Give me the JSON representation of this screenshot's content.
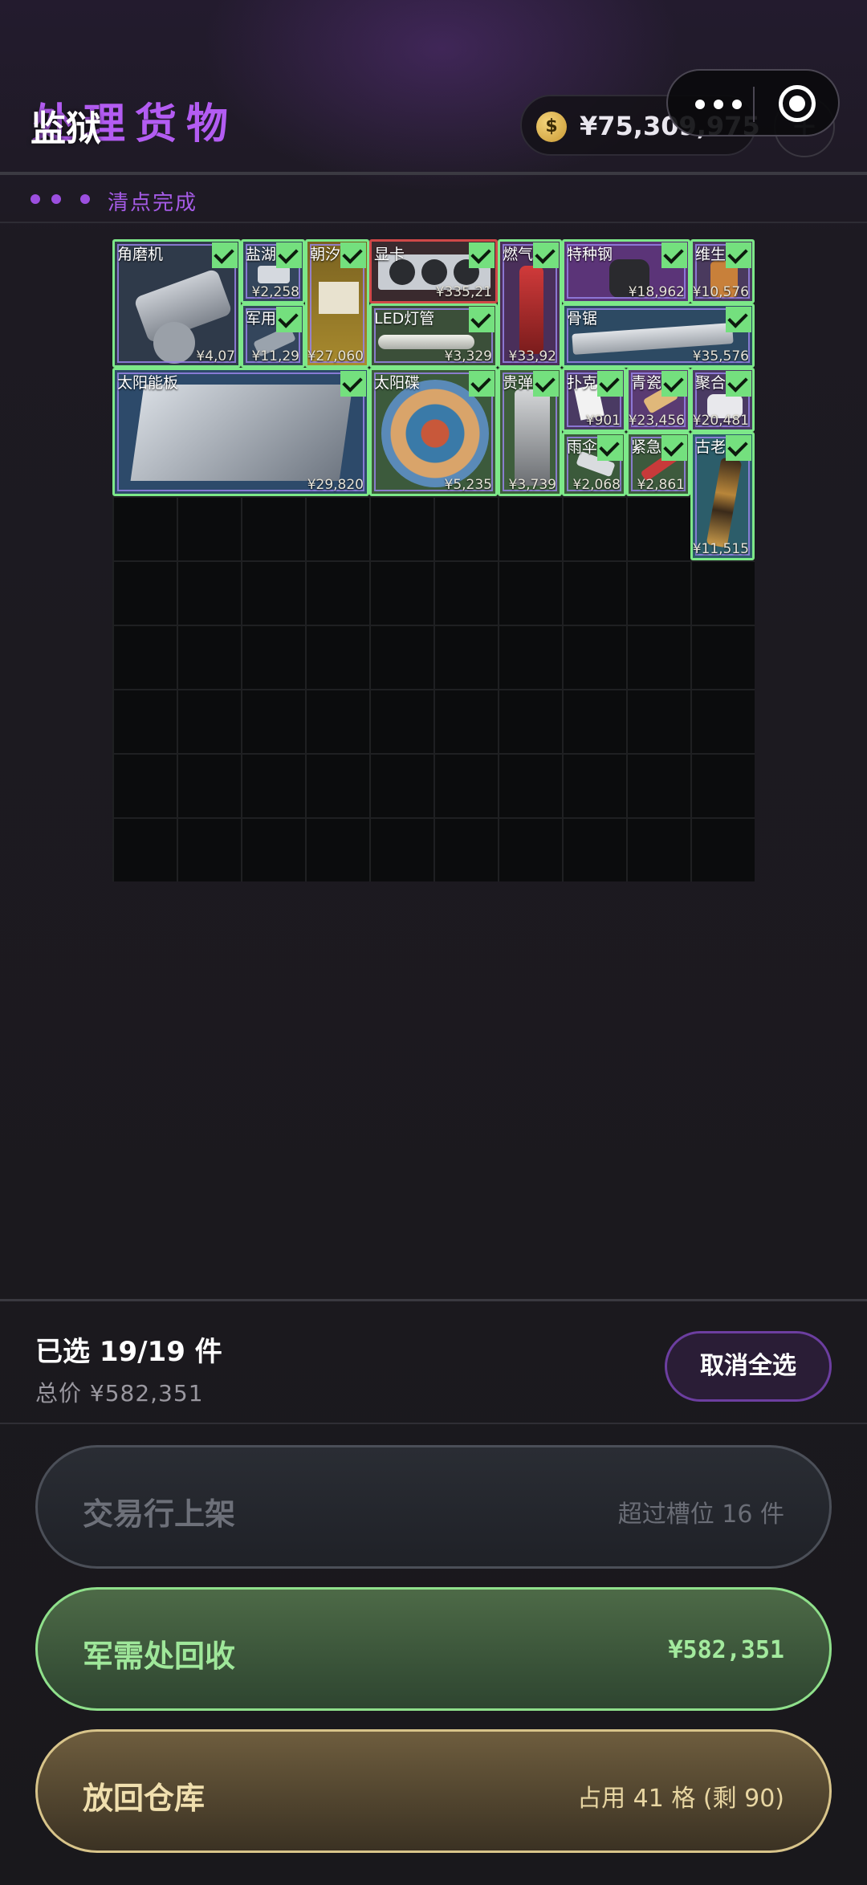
{
  "header": {
    "title": "处理货物",
    "overlay_title": "监狱",
    "balance": "¥75,309,975",
    "plus": "+",
    "progress_label": "清点完成"
  },
  "grid": {
    "items": [
      {
        "name": "角磨机",
        "price": "¥4,07",
        "color": "#2f3a4a"
      },
      {
        "name": "盐湖",
        "price": "¥2,258",
        "color": "#34465c"
      },
      {
        "name": "朝汐",
        "price": "¥27,060",
        "color": "#8a6d1e"
      },
      {
        "name": "显卡",
        "price": "¥335,21",
        "color": "#3a2a2e"
      },
      {
        "name": "燃气",
        "price": "¥33,92",
        "color": "#4a2f5a"
      },
      {
        "name": "特种钢",
        "price": "¥18,962",
        "color": "#5b3478"
      },
      {
        "name": "维生",
        "price": "¥10,576",
        "color": "#4a3a5e"
      },
      {
        "name": "军用",
        "price": "¥11,29",
        "color": "#34465c"
      },
      {
        "name": "LED灯管",
        "price": "¥3,329",
        "color": "#3b4f39"
      },
      {
        "name": "骨锯",
        "price": "¥35,576",
        "color": "#2d4a63"
      },
      {
        "name": "太阳能板",
        "price": "¥29,820",
        "color": "#2d4a6a"
      },
      {
        "name": "太阳碟",
        "price": "¥5,235",
        "color": "#3c5a3c"
      },
      {
        "name": "贵弹",
        "price": "¥3,739",
        "color": "#3e5e3c"
      },
      {
        "name": "扑克",
        "price": "¥901",
        "color": "#4a3a63"
      },
      {
        "name": "青瓷",
        "price": "¥23,456",
        "color": "#5a3b72"
      },
      {
        "name": "聚合",
        "price": "¥20,481",
        "color": "#4a3a63"
      },
      {
        "name": "雨伞",
        "price": "¥2,068",
        "color": "#3b5a3b"
      },
      {
        "name": "紧急",
        "price": "¥2,861",
        "color": "#3d5a3d"
      },
      {
        "name": "古老",
        "price": "¥11,515",
        "color": "#2c5d6a"
      }
    ]
  },
  "footer": {
    "selected": "已选 19/19 件",
    "total": "总价 ¥582,351",
    "deselect": "取消全选",
    "market_label": "交易行上架",
    "market_note": "超过槽位 16 件",
    "recycle_label": "军需处回收",
    "recycle_value": "¥582,351",
    "warehouse_label": "放回仓库",
    "warehouse_note": "占用 41 格 (剩 90)"
  },
  "colors": {
    "accent_purple": "#b35cf2",
    "selected_green": "#7de889",
    "recycle_green": "#8fe08b",
    "warehouse_gold": "#d8c48a"
  }
}
